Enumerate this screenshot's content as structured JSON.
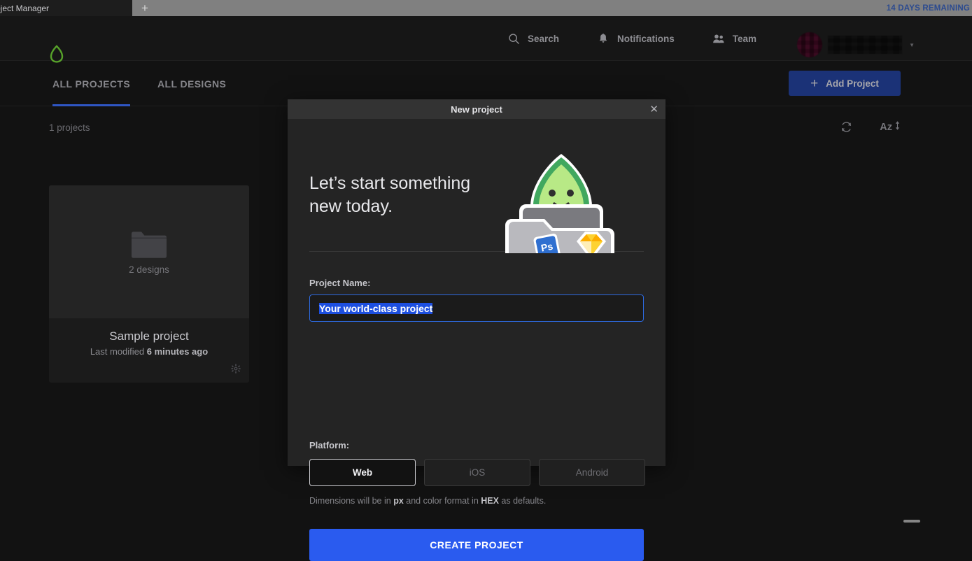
{
  "browser": {
    "tab_title": "oject Manager",
    "new_tab_icon": "plus-icon",
    "trial_notice": "14 DAYS REMAINING"
  },
  "header": {
    "logo_icon": "avocado-logo-icon",
    "nav": [
      {
        "label": "Search",
        "icon": "search-icon"
      },
      {
        "label": "Notifications",
        "icon": "bell-icon"
      },
      {
        "label": "Team",
        "icon": "people-icon"
      }
    ],
    "user": {
      "avatar_icon": "user-avatar",
      "name": "",
      "chevron_icon": "chevron-down-icon"
    }
  },
  "tabs": {
    "items": [
      {
        "label": "ALL PROJECTS",
        "active": true
      },
      {
        "label": "ALL DESIGNS",
        "active": false
      }
    ],
    "add_project": {
      "label": "Add Project",
      "icon": "plus-icon"
    }
  },
  "toolbar": {
    "count_label": "1 projects",
    "refresh_icon": "refresh-icon",
    "sort_label": "Az",
    "sort_icon": "sort-updown-icon"
  },
  "projects": [
    {
      "thumb_icon": "folder-icon",
      "designs_count": "2 designs",
      "title": "Sample project",
      "modified_prefix": "Last modified ",
      "modified_value": "6 minutes ago",
      "gear_icon": "gear-icon"
    }
  ],
  "modal": {
    "window_title": "New project",
    "close_icon": "close-icon",
    "heading": "Let’s start something\nnew today.",
    "illustration_icon": "avocado-laptop-illustration",
    "name_field": {
      "label": "Project Name:",
      "value": "Your world-class project",
      "placeholder": "Your world-class project"
    },
    "platform": {
      "label": "Platform:",
      "options": [
        "Web",
        "iOS",
        "Android"
      ],
      "selected": "Web"
    },
    "dims_note": {
      "part1": "Dimensions will be in ",
      "unit": "px",
      "part2": " and color format in ",
      "format": "HEX",
      "part3": " as defaults."
    },
    "create_button": "CREATE PROJECT"
  },
  "colors": {
    "page_bg": "#121212",
    "modal_bg": "#242424",
    "accent_blue": "#2a5bef",
    "tab_underline": "#2f56c4",
    "trial_blue": "#2b4a8f",
    "logo_green": "#57a22a"
  }
}
